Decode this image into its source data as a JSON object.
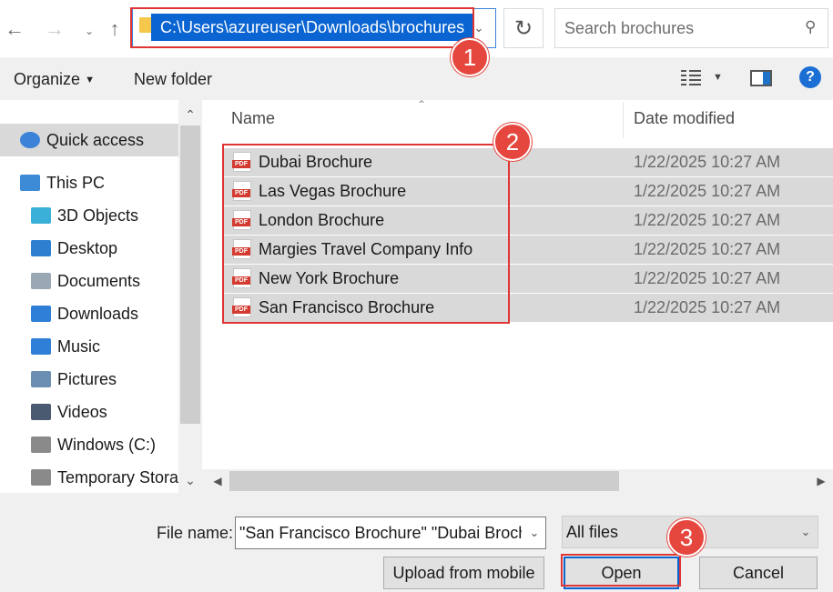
{
  "address": {
    "path": "C:\\Users\\azureuser\\Downloads\\brochures",
    "search_placeholder": "Search brochures"
  },
  "toolbar": {
    "organize_label": "Organize",
    "new_folder_label": "New folder",
    "help_label": "?"
  },
  "sidebar": {
    "items": [
      {
        "label": "Quick access",
        "icon": "star-icon"
      },
      {
        "label": "This PC",
        "icon": "computer-icon"
      },
      {
        "label": "3D Objects",
        "icon": "cube-icon"
      },
      {
        "label": "Desktop",
        "icon": "desktop-icon"
      },
      {
        "label": "Documents",
        "icon": "documents-icon"
      },
      {
        "label": "Downloads",
        "icon": "download-arrow-icon"
      },
      {
        "label": "Music",
        "icon": "music-note-icon"
      },
      {
        "label": "Pictures",
        "icon": "picture-icon"
      },
      {
        "label": "Videos",
        "icon": "film-icon"
      },
      {
        "label": "Windows (C:)",
        "icon": "drive-icon"
      },
      {
        "label": "Temporary Stora",
        "icon": "drive-icon"
      }
    ]
  },
  "file_list": {
    "columns": [
      "Name",
      "Date modified"
    ],
    "rows": [
      {
        "name": "Dubai Brochure",
        "date": "1/22/2025 10:27 AM"
      },
      {
        "name": "Las Vegas Brochure",
        "date": "1/22/2025 10:27 AM"
      },
      {
        "name": "London Brochure",
        "date": "1/22/2025 10:27 AM"
      },
      {
        "name": "Margies Travel Company Info",
        "date": "1/22/2025 10:27 AM"
      },
      {
        "name": "New York Brochure",
        "date": "1/22/2025 10:27 AM"
      },
      {
        "name": "San Francisco Brochure",
        "date": "1/22/2025 10:27 AM"
      }
    ],
    "file_icon_text": "PDF"
  },
  "bottom": {
    "file_name_label": "File name:",
    "file_name_value": "\"San Francisco Brochure\" \"Dubai Brochure\"",
    "file_type_value": "All files",
    "upload_label": "Upload from mobile",
    "open_label": "Open",
    "cancel_label": "Cancel"
  },
  "callouts": [
    "1",
    "2",
    "3"
  ],
  "colors": {
    "selection": "#0a64d2",
    "callout_red": "#e5473f",
    "row_selected": "#d9d9d9"
  }
}
